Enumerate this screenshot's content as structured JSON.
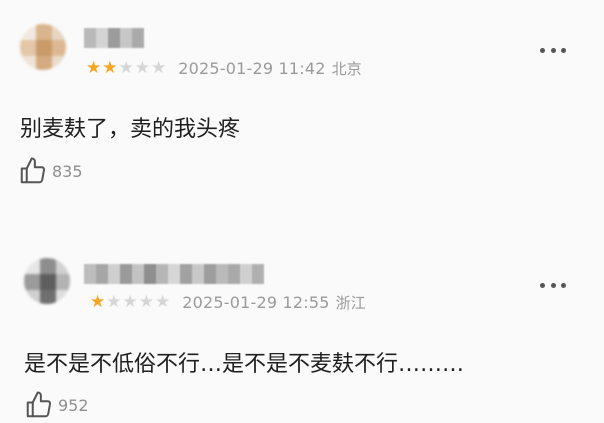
{
  "comments": [
    {
      "stars_filled": 2,
      "stars_total": 5,
      "timestamp": "2025-01-29 11:42",
      "location": "北京",
      "text": "别麦麸了，卖的我头疼",
      "likes": "835"
    },
    {
      "stars_filled": 1,
      "stars_total": 5,
      "timestamp": "2025-01-29 12:55",
      "location": "浙江",
      "text": "是不是不低俗不行…是不是不麦麸不行………",
      "likes": "952"
    }
  ],
  "colors": {
    "star_on": "#f5a623",
    "star_off": "#d6d6d6",
    "meta_text": "#9a9a9a",
    "body_text": "#1f1f1f"
  }
}
